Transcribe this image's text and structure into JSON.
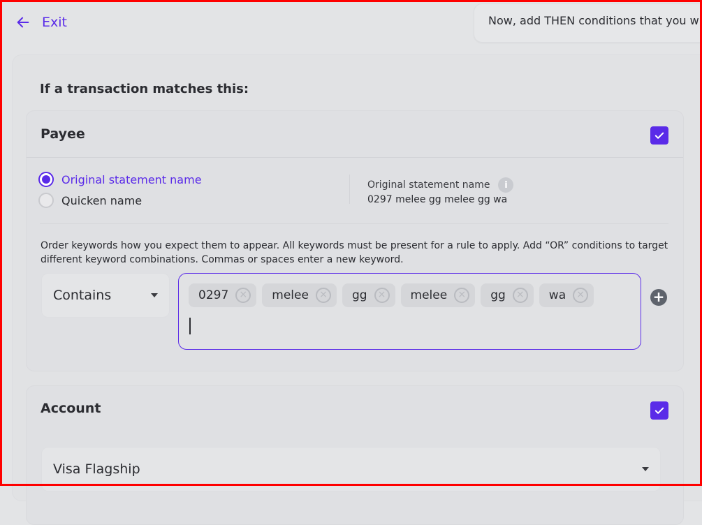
{
  "nav": {
    "exit_label": "Exit"
  },
  "hint": {
    "text": "Now, add THEN conditions that you w"
  },
  "rule": {
    "heading": "If a transaction matches this:"
  },
  "payee": {
    "title": "Payee",
    "checked": true,
    "options": [
      {
        "label": "Original statement name",
        "selected": true
      },
      {
        "label": "Quicken name",
        "selected": false
      }
    ],
    "osn_title": "Original statement name",
    "osn_value": "0297 melee gg melee gg wa",
    "instructions": "Order keywords how you expect them to appear. All keywords must be present for a rule to apply. Add “OR” conditions to target different keyword combinations. Commas or spaces enter a new keyword.",
    "match_type": "Contains",
    "keywords": [
      "0297",
      "melee",
      "gg",
      "melee",
      "gg",
      "wa"
    ]
  },
  "account": {
    "title": "Account",
    "checked": true,
    "selected_account": "Visa Flagship"
  },
  "colors": {
    "accent": "#5a2be8",
    "background": "#e3e4e6"
  },
  "icons": {
    "exit": "arrow-left-icon",
    "check": "check-icon",
    "info": "info-icon",
    "remove": "close-circle-icon",
    "add": "plus-circle-icon"
  }
}
